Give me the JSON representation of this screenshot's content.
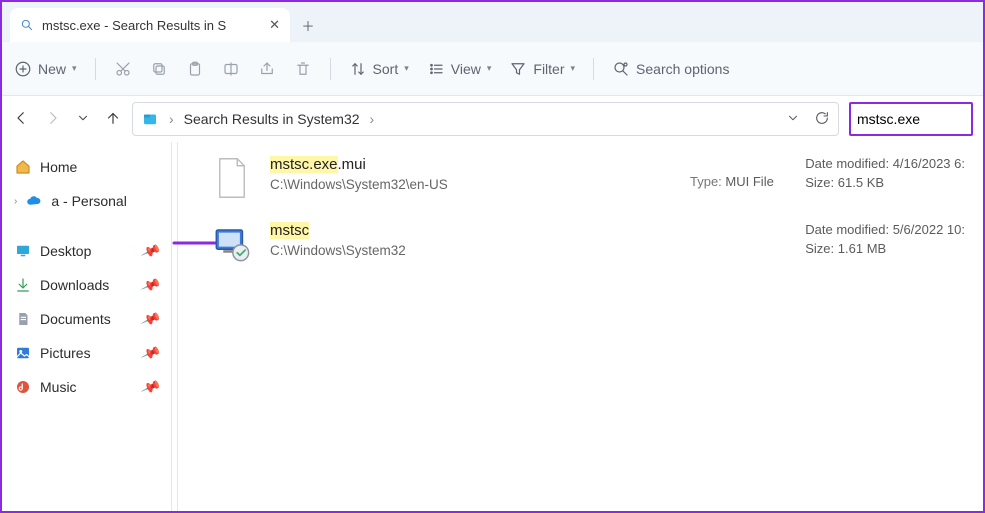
{
  "tab": {
    "title": "mstsc.exe - Search Results in S"
  },
  "toolbar": {
    "new_label": "New",
    "sort_label": "Sort",
    "view_label": "View",
    "filter_label": "Filter",
    "search_options_label": "Search options"
  },
  "address": {
    "crumb1": "Search Results in System32"
  },
  "search": {
    "value": "mstsc.exe"
  },
  "nav": {
    "home": "Home",
    "personal": "a - Personal",
    "desktop": "Desktop",
    "downloads": "Downloads",
    "documents": "Documents",
    "pictures": "Pictures",
    "music": "Music"
  },
  "results": [
    {
      "name_hl": "mstsc.exe",
      "name_suffix": ".mui",
      "path": "C:\\Windows\\System32\\en-US",
      "type_label": "Type:",
      "type_value": "MUI File",
      "date_label": "Date modified:",
      "date_value": "4/16/2023 6:",
      "size_label": "Size:",
      "size_value": "61.5 KB"
    },
    {
      "name_hl": "mstsc",
      "name_suffix": "",
      "path": "C:\\Windows\\System32",
      "type_label": "",
      "type_value": "",
      "date_label": "Date modified:",
      "date_value": "5/6/2022 10:",
      "size_label": "Size:",
      "size_value": "1.61 MB"
    }
  ]
}
